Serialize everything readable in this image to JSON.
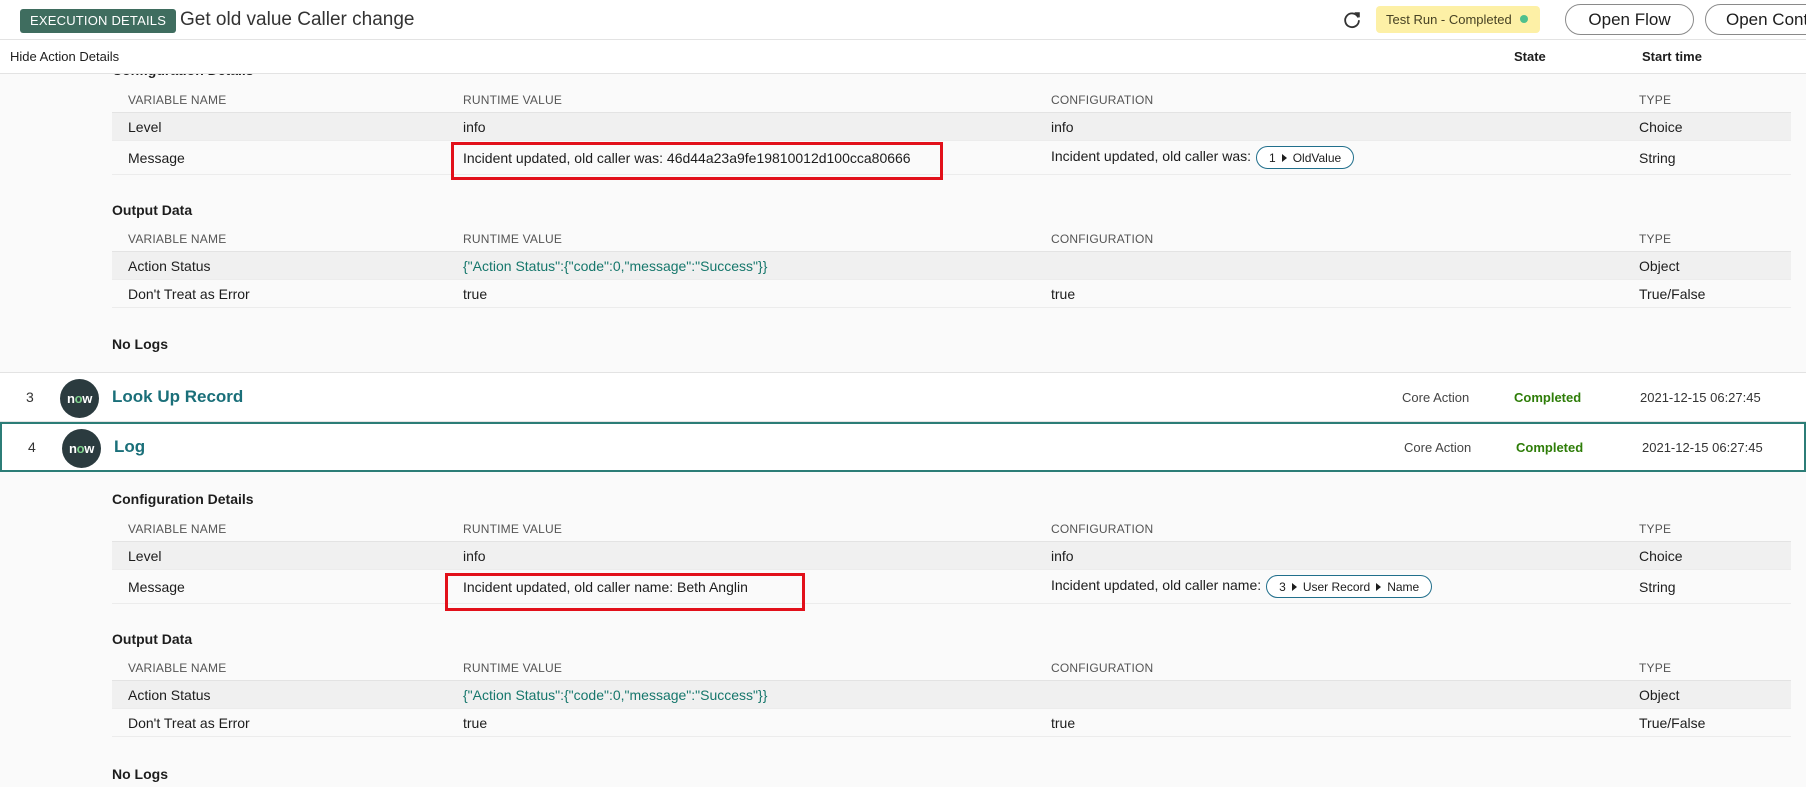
{
  "topbar": {
    "badge": "EXECUTION DETAILS",
    "title": "Get old value Caller change",
    "run_status": "Test Run - Completed",
    "open_flow": "Open Flow",
    "open_context": "Open Context"
  },
  "header": {
    "hide_details": "Hide Action Details",
    "state": "State",
    "start_time": "Start time"
  },
  "columns": {
    "variable_name": "VARIABLE NAME",
    "runtime_value": "RUNTIME VALUE",
    "configuration": "CONFIGURATION",
    "type": "TYPE"
  },
  "sections": {
    "configuration_details": "Configuration Details",
    "output_data": "Output Data",
    "no_logs": "No Logs"
  },
  "block1": {
    "config_rows": [
      {
        "name": "Level",
        "runtime": "info",
        "config": "info",
        "type": "Choice"
      },
      {
        "name": "Message",
        "runtime": "Incident updated, old caller was: 46d44a23a9fe19810012d100cca80666",
        "config": "Incident updated, old caller was:",
        "pill": [
          "1",
          "OldValue"
        ],
        "type": "String"
      }
    ],
    "output_rows": [
      {
        "name": "Action Status",
        "runtime": "{\"Action Status\":{\"code\":0,\"message\":\"Success\"}}",
        "config": "",
        "type": "Object"
      },
      {
        "name": "Don't Treat as Error",
        "runtime": "true",
        "config": "true",
        "type": "True/False"
      }
    ]
  },
  "steps": [
    {
      "num": "3",
      "name": "Look Up Record",
      "type": "Core Action",
      "state": "Completed",
      "time": "2021-12-15 06:27:45"
    },
    {
      "num": "4",
      "name": "Log",
      "type": "Core Action",
      "state": "Completed",
      "time": "2021-12-15 06:27:45"
    }
  ],
  "block2": {
    "config_rows": [
      {
        "name": "Level",
        "runtime": "info",
        "config": "info",
        "type": "Choice"
      },
      {
        "name": "Message",
        "runtime": "Incident updated, old caller name: Beth Anglin",
        "config": "Incident updated, old caller name:",
        "pill": [
          "3",
          "User Record",
          "Name"
        ],
        "type": "String"
      }
    ],
    "output_rows": [
      {
        "name": "Action Status",
        "runtime": "{\"Action Status\":{\"code\":0,\"message\":\"Success\"}}",
        "config": "",
        "type": "Object"
      },
      {
        "name": "Don't Treat as Error",
        "runtime": "true",
        "config": "true",
        "type": "True/False"
      }
    ]
  },
  "logo_text": "now",
  "colors": {
    "badge_green": "#3f6d5f",
    "teal_link": "#1a6f79",
    "status_yellow": "#fdf0a6",
    "completed_green": "#2e7d08",
    "highlight_red": "#e2101a"
  }
}
